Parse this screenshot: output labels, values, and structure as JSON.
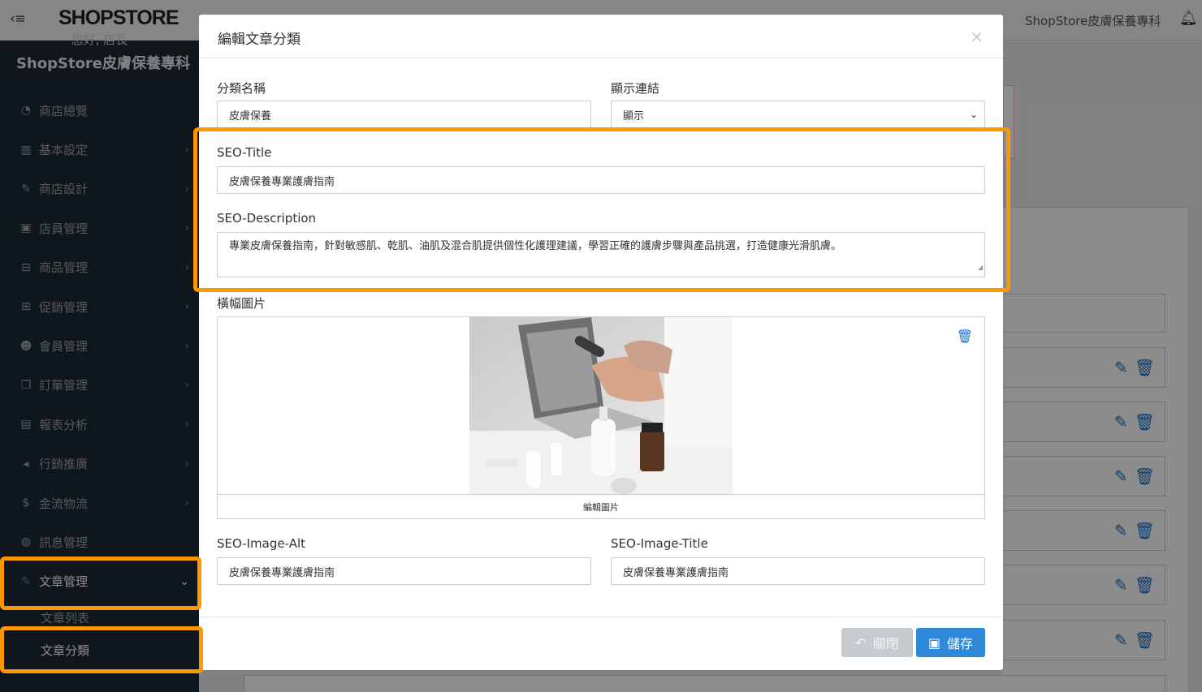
{
  "topbar": {
    "logo": "SHOPSTORE",
    "store_name": "ShopStore皮膚保養專科"
  },
  "sidebar": {
    "greeting": "您好, 店長",
    "store_name": "ShopStore皮膚保養專科",
    "items": [
      {
        "label": "商店總覽",
        "icon": "dashboard-icon"
      },
      {
        "label": "基本設定",
        "icon": "bank-icon"
      },
      {
        "label": "商店設計",
        "icon": "magic-wand-icon"
      },
      {
        "label": "店員管理",
        "icon": "lock-icon"
      },
      {
        "label": "商品管理",
        "icon": "cart-icon"
      },
      {
        "label": "促銷管理",
        "icon": "gift-icon"
      },
      {
        "label": "會員管理",
        "icon": "users-icon"
      },
      {
        "label": "訂單管理",
        "icon": "copy-icon"
      },
      {
        "label": "報表分析",
        "icon": "bar-chart-icon"
      },
      {
        "label": "行銷推廣",
        "icon": "bullhorn-icon"
      },
      {
        "label": "金流物流",
        "icon": "dollar-icon"
      },
      {
        "label": "訊息管理",
        "icon": "comments-icon"
      },
      {
        "label": "文章管理",
        "icon": "edit-icon"
      }
    ],
    "subitems": [
      {
        "label": "文章列表"
      },
      {
        "label": "文章分類"
      }
    ]
  },
  "modal": {
    "title": "編輯文章分類",
    "category_name_label": "分類名稱",
    "category_name_value": "皮膚保養",
    "display_link_label": "顯示連結",
    "display_link_value": "顯示",
    "seo_title_label": "SEO-Title",
    "seo_title_value": "皮膚保養專業護膚指南",
    "seo_description_label": "SEO-Description",
    "seo_description_value": "專業皮膚保養指南，針對敏感肌、乾肌、油肌及混合肌提供個性化護理建議，學習正確的護膚步驟與產品挑選，打造健康光滑肌膚。",
    "banner_label": "橫幅圖片",
    "edit_image_label": "編輯圖片",
    "seo_image_alt_label": "SEO-Image-Alt",
    "seo_image_alt_value": "皮膚保養專業護膚指南",
    "seo_image_title_label": "SEO-Image-Title",
    "seo_image_title_value": "皮膚保養專業護膚指南",
    "close_button": "關閉",
    "save_button": "儲存"
  },
  "colors": {
    "highlight": "#ff9800",
    "primary": "#2e8ad8",
    "sidebar_bg": "#1c2a33"
  }
}
